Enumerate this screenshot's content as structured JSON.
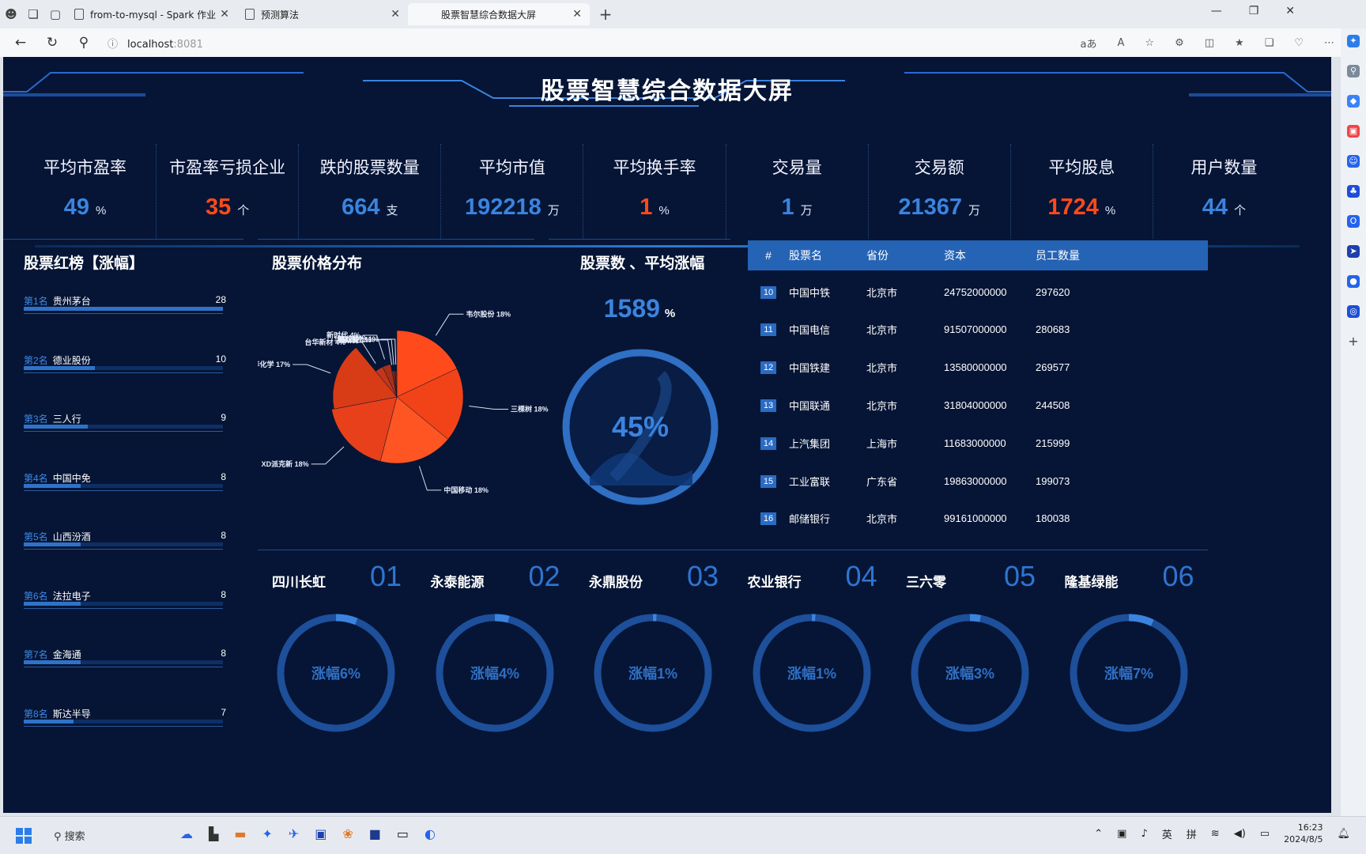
{
  "browser": {
    "tabs": [
      {
        "label": "from-to-mysql - Spark 作业"
      },
      {
        "label": "预测算法"
      },
      {
        "label": "股票智慧综合数据大屏"
      }
    ],
    "url_host": "localhost",
    "url_port": ":8081"
  },
  "dashboard": {
    "title": "股票智慧综合数据大屏",
    "kpis": [
      {
        "label": "平均市盈率",
        "value": "49",
        "unit": "%",
        "color": "#3a84df"
      },
      {
        "label": "市盈率亏损企业",
        "value": "35",
        "unit": "个",
        "color": "#ff4a1c"
      },
      {
        "label": "跌的股票数量",
        "value": "664",
        "unit": "支",
        "color": "#3a84df"
      },
      {
        "label": "平均市值",
        "value": "192218",
        "unit": "万",
        "color": "#3a84df"
      },
      {
        "label": "平均换手率",
        "value": "1",
        "unit": "%",
        "color": "#ff4a1c"
      },
      {
        "label": "交易量",
        "value": "1",
        "unit": "万",
        "color": "#3a84df"
      },
      {
        "label": "交易额",
        "value": "21367",
        "unit": "万",
        "color": "#3a84df"
      },
      {
        "label": "平均股息",
        "value": "1724",
        "unit": "%",
        "color": "#ff4a1c"
      },
      {
        "label": "用户数量",
        "value": "44",
        "unit": "个",
        "color": "#3a84df"
      }
    ],
    "ranking": {
      "title": "股票红榜【涨幅】",
      "items": [
        {
          "rank": "第1名",
          "name": "贵州茅台",
          "value": 28
        },
        {
          "rank": "第2名",
          "name": "德业股份",
          "value": 10
        },
        {
          "rank": "第3名",
          "name": "三人行",
          "value": 9
        },
        {
          "rank": "第4名",
          "name": "中国中免",
          "value": 8
        },
        {
          "rank": "第5名",
          "name": "山西汾酒",
          "value": 8
        },
        {
          "rank": "第6名",
          "name": "法拉电子",
          "value": 8
        },
        {
          "rank": "第7名",
          "name": "金海通",
          "value": 8
        },
        {
          "rank": "第8名",
          "name": "斯达半导",
          "value": 7
        }
      ]
    },
    "pie": {
      "title": "股票价格分布"
    },
    "gauge": {
      "title": "股票数 、平均涨幅",
      "count_value": "1589",
      "count_unit": "%",
      "percent_text": "45%",
      "percent": 45
    },
    "table": {
      "headers": [
        "#",
        "股票名",
        "省份",
        "资本",
        "员工数量"
      ],
      "rows": [
        {
          "idx": "10",
          "name": "中国中铁",
          "province": "北京市",
          "capital": "24752000000",
          "employees": "297620"
        },
        {
          "idx": "11",
          "name": "中国电信",
          "province": "北京市",
          "capital": "91507000000",
          "employees": "280683"
        },
        {
          "idx": "12",
          "name": "中国铁建",
          "province": "北京市",
          "capital": "13580000000",
          "employees": "269577"
        },
        {
          "idx": "13",
          "name": "中国联通",
          "province": "北京市",
          "capital": "31804000000",
          "employees": "244508"
        },
        {
          "idx": "14",
          "name": "上汽集团",
          "province": "上海市",
          "capital": "11683000000",
          "employees": "215999"
        },
        {
          "idx": "15",
          "name": "工业富联",
          "province": "广东省",
          "capital": "19863000000",
          "employees": "199073"
        },
        {
          "idx": "16",
          "name": "邮储银行",
          "province": "北京市",
          "capital": "99161000000",
          "employees": "180038"
        }
      ]
    },
    "gauges_bottom": [
      {
        "name": "四川长虹",
        "num": "01",
        "text": "涨幅6%",
        "pct": 6
      },
      {
        "name": "永泰能源",
        "num": "02",
        "text": "涨幅4%",
        "pct": 4
      },
      {
        "name": "永鼎股份",
        "num": "03",
        "text": "涨幅1%",
        "pct": 1
      },
      {
        "name": "农业银行",
        "num": "04",
        "text": "涨幅1%",
        "pct": 1
      },
      {
        "name": "三六零",
        "num": "05",
        "text": "涨幅3%",
        "pct": 3
      },
      {
        "name": "隆基绿能",
        "num": "06",
        "text": "涨幅7%",
        "pct": 7
      }
    ]
  },
  "chart_data": {
    "type": "pie",
    "title": "股票价格分布",
    "slices": [
      {
        "label": "韦尔股份",
        "value": 18
      },
      {
        "label": "三棵树",
        "value": 18
      },
      {
        "label": "中国移动",
        "value": 18
      },
      {
        "label": "XD派克新",
        "value": 18
      },
      {
        "label": "万华化学",
        "value": 17
      },
      {
        "label": "台华新材",
        "value": 4
      },
      {
        "label": "新时代",
        "value": 4
      },
      {
        "label": "福斯特",
        "value": 1
      },
      {
        "label": "华峰测控",
        "value": 1
      },
      {
        "label": "德业股份",
        "value": 1
      }
    ]
  },
  "taskbar": {
    "search_label": "搜索",
    "lang": "英",
    "ime": "拼",
    "time": "16:23",
    "date": "2024/8/5"
  }
}
